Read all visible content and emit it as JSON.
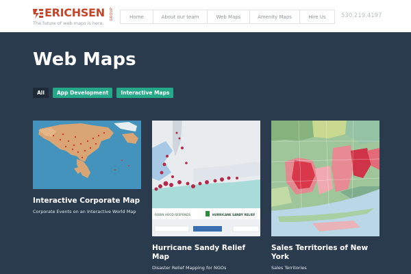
{
  "brand": {
    "name": "ERICHSEN",
    "group": "GROUP",
    "tagline": "The future of web maps is here.",
    "accent_color": "#c4452b"
  },
  "nav": {
    "items": [
      "Home",
      "About our team",
      "Web Maps",
      "Amenity Maps",
      "Hire Us"
    ]
  },
  "phone": "530.219.4197",
  "page": {
    "title": "Web Maps"
  },
  "filters": [
    "All",
    "App Development",
    "Interactive Maps"
  ],
  "colors": {
    "background": "#2b3b4e",
    "filter_active": "#1e2a37",
    "filter_tag": "#25a989"
  },
  "cards": [
    {
      "title": "Interactive Corporate Map",
      "subtitle": "Corporate Events on an Interactive World Map",
      "thumb_icon": "world-map-thumbnail"
    },
    {
      "title": "Hurricane Sandy Relief Map",
      "subtitle": "Disaster Relief Mapping for NGOs",
      "thumb_icon": "relief-map-thumbnail",
      "banner_left": "ROBIN HOOD RESPONDS",
      "banner_right": "HURRICANE SANDY RELIEF"
    },
    {
      "title": "Sales Territories of New York",
      "subtitle": "Sales Territories",
      "thumb_icon": "territory-map-thumbnail"
    }
  ]
}
